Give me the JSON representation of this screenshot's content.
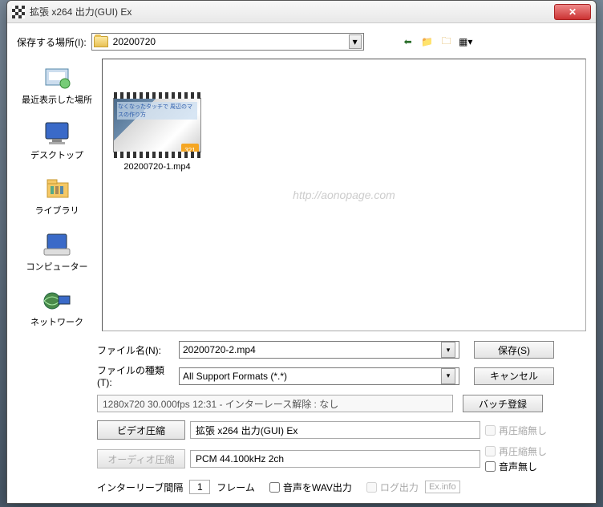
{
  "title": "拡張 x264 出力(GUI) Ex",
  "location_label": "保存する場所(I):",
  "location_value": "20200720",
  "sidebar": [
    {
      "label": "最近表示した場所"
    },
    {
      "label": "デスクトップ"
    },
    {
      "label": "ライブラリ"
    },
    {
      "label": "コンピューター"
    },
    {
      "label": "ネットワーク"
    }
  ],
  "file_item": {
    "name": "20200720-1.mp4",
    "badge": "321",
    "thumb_text": "なくなったタッチで\n周辺のマスの作り方"
  },
  "watermark": "http://aonopage.com",
  "filename_label": "ファイル名(N):",
  "filename_value": "20200720-2.mp4",
  "filetype_label": "ファイルの種類(T):",
  "filetype_value": "All Support Formats (*.*)",
  "save_btn": "保存(S)",
  "cancel_btn": "キャンセル",
  "batch_btn": "バッチ登録",
  "info_text": "1280x720  30.000fps  12:31   -  インターレース解除 : なし",
  "video_btn": "ビデオ圧縮",
  "video_val": "拡張 x264 出力(GUI) Ex",
  "audio_btn": "オーディオ圧縮",
  "audio_val": "PCM 44.100kHz 2ch",
  "no_recompress": "再圧縮無し",
  "no_audio": "音声無し",
  "interleave_label": "インターリーブ間隔",
  "interleave_val": "1",
  "interleave_unit": "フレーム",
  "wav_out": "音声をWAV出力",
  "log_out": "ログ出力",
  "exinfo": "Ex.info"
}
